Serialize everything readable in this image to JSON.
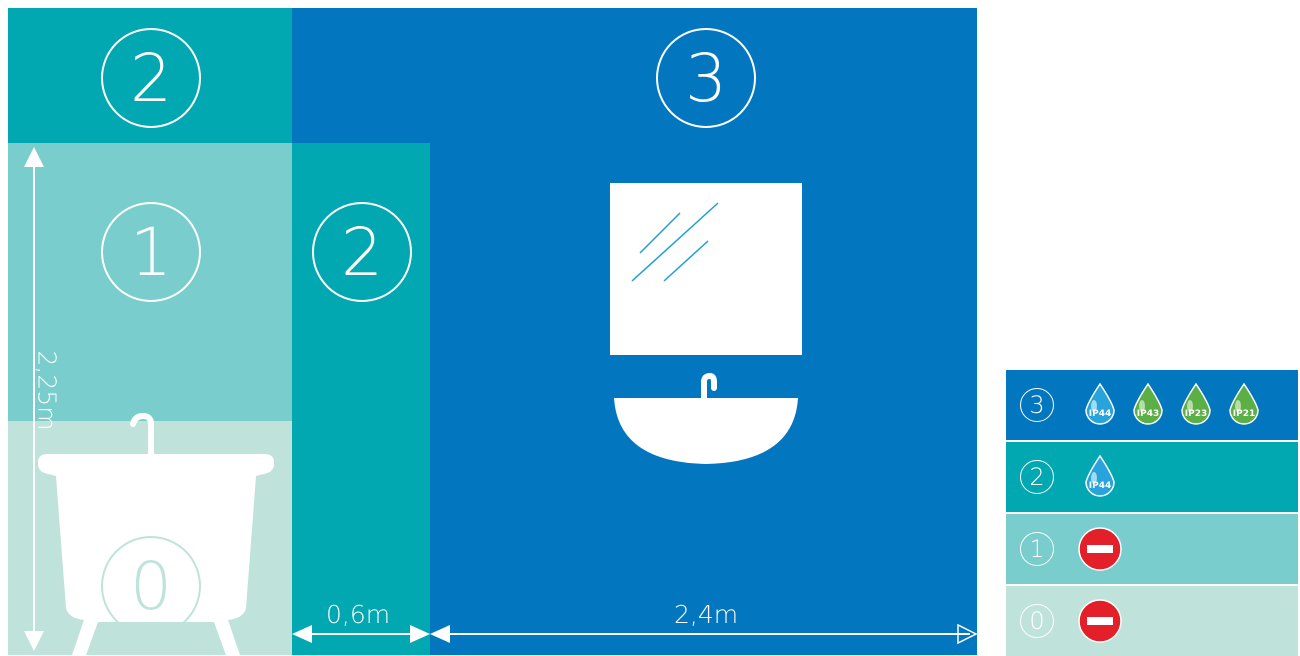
{
  "zones": {
    "zone0": "0",
    "zone1": "1",
    "zone2_top": "2",
    "zone2_side": "2",
    "zone3": "3"
  },
  "dimensions": {
    "height": "2,25m",
    "width_zone2": "0,6m",
    "width_zone3": "2,4m"
  },
  "legend": [
    {
      "zone": "3",
      "ratings": [
        "IP44",
        "IP43",
        "IP23",
        "IP21"
      ],
      "color": "#0277c0"
    },
    {
      "zone": "2",
      "ratings": [
        "IP44"
      ],
      "color": "#01a8b1"
    },
    {
      "zone": "1",
      "ratings": [],
      "icon": "no-entry-icon",
      "color": "#79cdcd"
    },
    {
      "zone": "0",
      "ratings": [],
      "icon": "no-entry-icon",
      "color": "#bfe3db"
    }
  ],
  "colors": {
    "zone3": "#0277c0",
    "zone2": "#01a8b1",
    "zone1": "#79cdcd",
    "zone0": "#bfe3db",
    "ip44_drop": "#29a3dc",
    "ip_other_drop": "#5cae46",
    "no_entry": "#e3202a"
  }
}
